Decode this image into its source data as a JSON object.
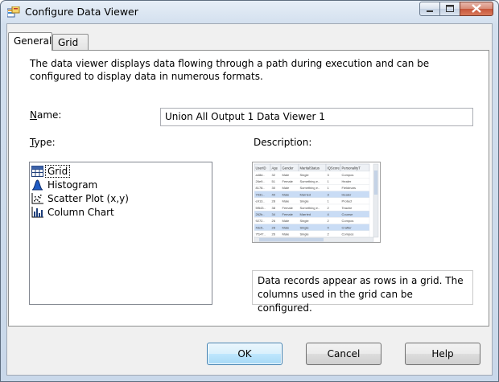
{
  "window": {
    "title": "Configure Data Viewer"
  },
  "tabs": [
    {
      "label": "General",
      "active": true
    },
    {
      "label": "Grid",
      "active": false
    }
  ],
  "general": {
    "intro": "The data viewer displays data flowing through a path during execution and can be configured to display data in numerous formats.",
    "name_label_u": "N",
    "name_label_rest": "ame:",
    "name_value": "Union All Output 1 Data Viewer 1",
    "type_label_u": "T",
    "type_label_rest": "ype:",
    "description_label": "Description:",
    "types": [
      {
        "label": "Grid",
        "icon": "grid-icon",
        "selected": true
      },
      {
        "label": "Histogram",
        "icon": "histogram-icon",
        "selected": false
      },
      {
        "label": "Scatter Plot (x,y)",
        "icon": "scatter-plot-icon",
        "selected": false
      },
      {
        "label": "Column Chart",
        "icon": "column-chart-icon",
        "selected": false
      }
    ],
    "description_text": "Data records appear as rows in a grid. The columns used in the grid can be configured."
  },
  "buttons": {
    "ok": "OK",
    "cancel": "Cancel",
    "help": "Help"
  },
  "preview_grid": {
    "headers": [
      "UserID",
      "Age",
      "Gender",
      "MaritalStatus",
      "IQScore",
      "PersonalityT"
    ],
    "rows": [
      [
        "a48d..",
        "32",
        "Male",
        "Single",
        "3",
        "Compos"
      ],
      [
        "26e9..",
        "51",
        "Female",
        "Something e..",
        "1",
        "Healer"
      ],
      [
        "8178..",
        "30",
        "Male",
        "Something e..",
        "1",
        "Fieldmars"
      ],
      [
        "7931..",
        "40",
        "Male",
        "Married",
        "3",
        "Healer"
      ],
      [
        "e913..",
        "28",
        "Male",
        "Single",
        "1",
        "Protect"
      ],
      [
        "5f543..",
        "38",
        "Female",
        "Something e..",
        "2",
        "Teache"
      ],
      [
        "262b..",
        "34",
        "Female",
        "Married",
        "4",
        "Counse"
      ],
      [
        "9272..",
        "26",
        "Male",
        "Single",
        "2",
        "Compos"
      ],
      [
        "4dc5..",
        "28",
        "Male",
        "Single",
        "4",
        "Crafter"
      ],
      [
        "7f147..",
        "26",
        "Male",
        "Single",
        "2",
        "Compos"
      ]
    ],
    "highlighted_rows": [
      3,
      6,
      8
    ]
  },
  "colors": {
    "selection": "#c9dcf5",
    "accent": "#3c7fb1"
  }
}
